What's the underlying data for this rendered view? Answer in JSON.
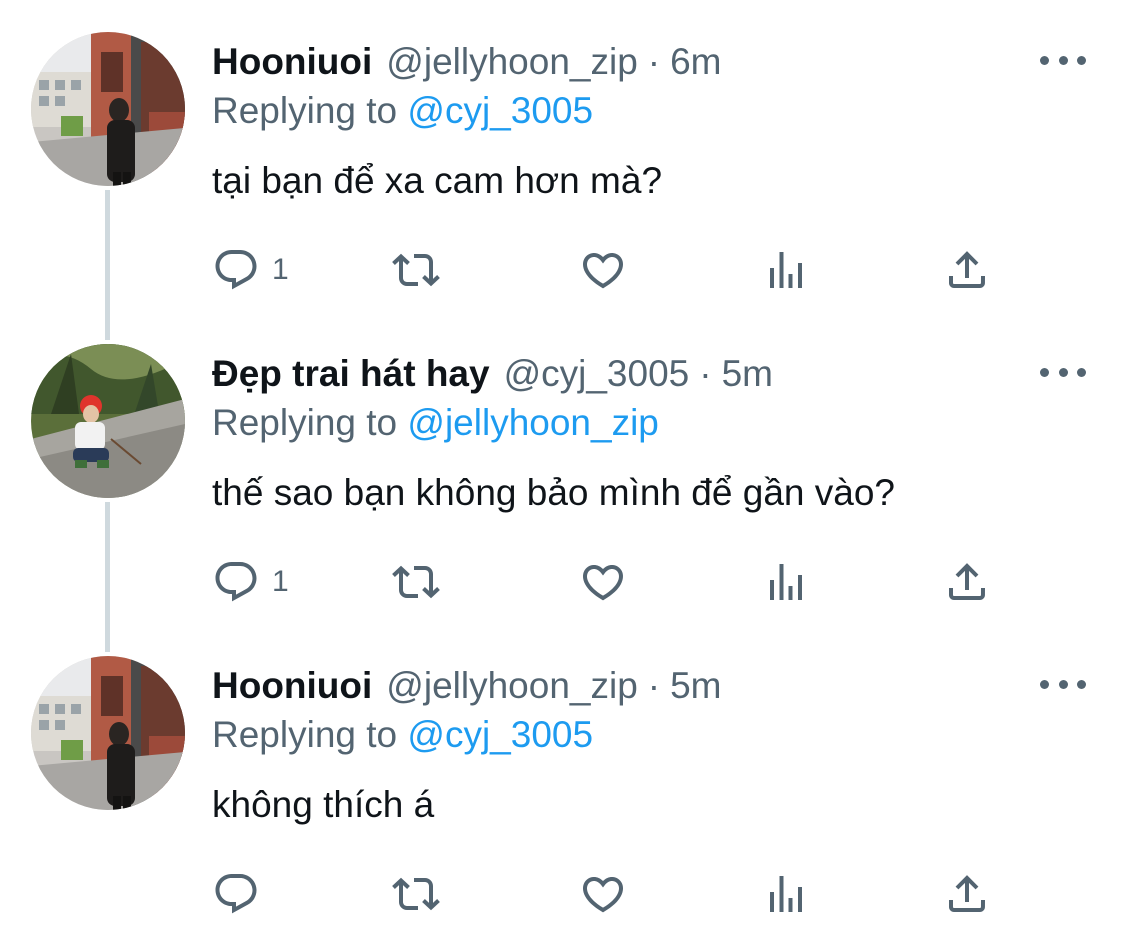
{
  "colors": {
    "text": "#0f1419",
    "secondary": "#536471",
    "link": "#1d9bf0",
    "thread_line": "#cfd9de"
  },
  "tweets": [
    {
      "display_name": "Hooniuoi",
      "handle": "@jellyhoon_zip",
      "separator": "·",
      "time": "6m",
      "replying_prefix": "Replying to",
      "replying_to": "@cyj_3005",
      "text": "tại bạn để xa cam hơn mà?",
      "reply_count": "1",
      "avatar_icon": "avatar-photo-alley"
    },
    {
      "display_name": "Đẹp trai hát hay",
      "handle": "@cyj_3005",
      "separator": "·",
      "time": "5m",
      "replying_prefix": "Replying to",
      "replying_to": "@jellyhoon_zip",
      "text": "thế sao bạn không bảo mình để gần vào?",
      "reply_count": "1",
      "avatar_icon": "avatar-photo-red-hair"
    },
    {
      "display_name": "Hooniuoi",
      "handle": "@jellyhoon_zip",
      "separator": "·",
      "time": "5m",
      "replying_prefix": "Replying to",
      "replying_to": "@cyj_3005",
      "text": "không thích á",
      "reply_count": "",
      "avatar_icon": "avatar-photo-alley"
    }
  ]
}
